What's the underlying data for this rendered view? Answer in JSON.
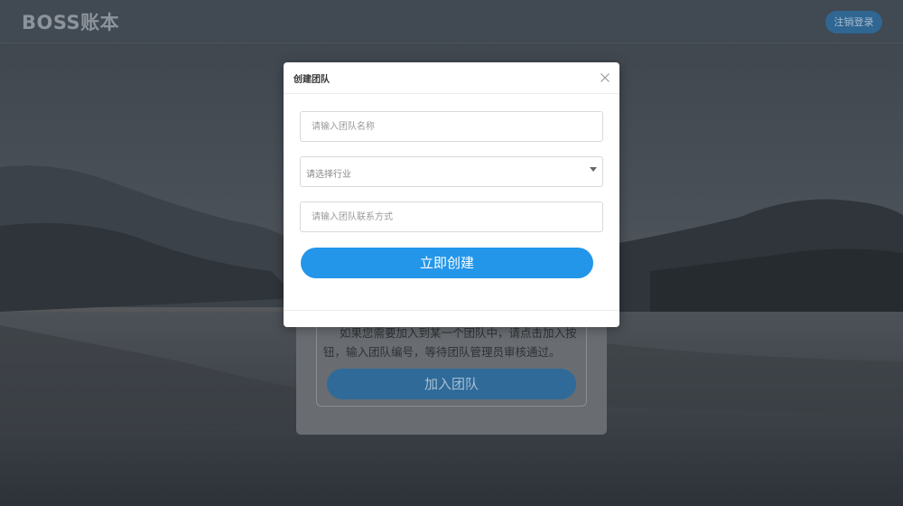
{
  "app": {
    "logo": "BOSS账本"
  },
  "header": {
    "logout_label": "注销登录"
  },
  "join_card": {
    "description": "如果您需要加入到某一个团队中，请点击加入按钮，输入团队编号，等待团队管理员审核通过。",
    "join_button": "加入团队"
  },
  "modal": {
    "title": "创建团队",
    "team_name_placeholder": "请输入团队名称",
    "industry_placeholder": "请选择行业",
    "contact_placeholder": "请输入团队联系方式",
    "create_button": "立即创建"
  },
  "colors": {
    "accent": "#2396ea",
    "topbar": "#414952"
  }
}
